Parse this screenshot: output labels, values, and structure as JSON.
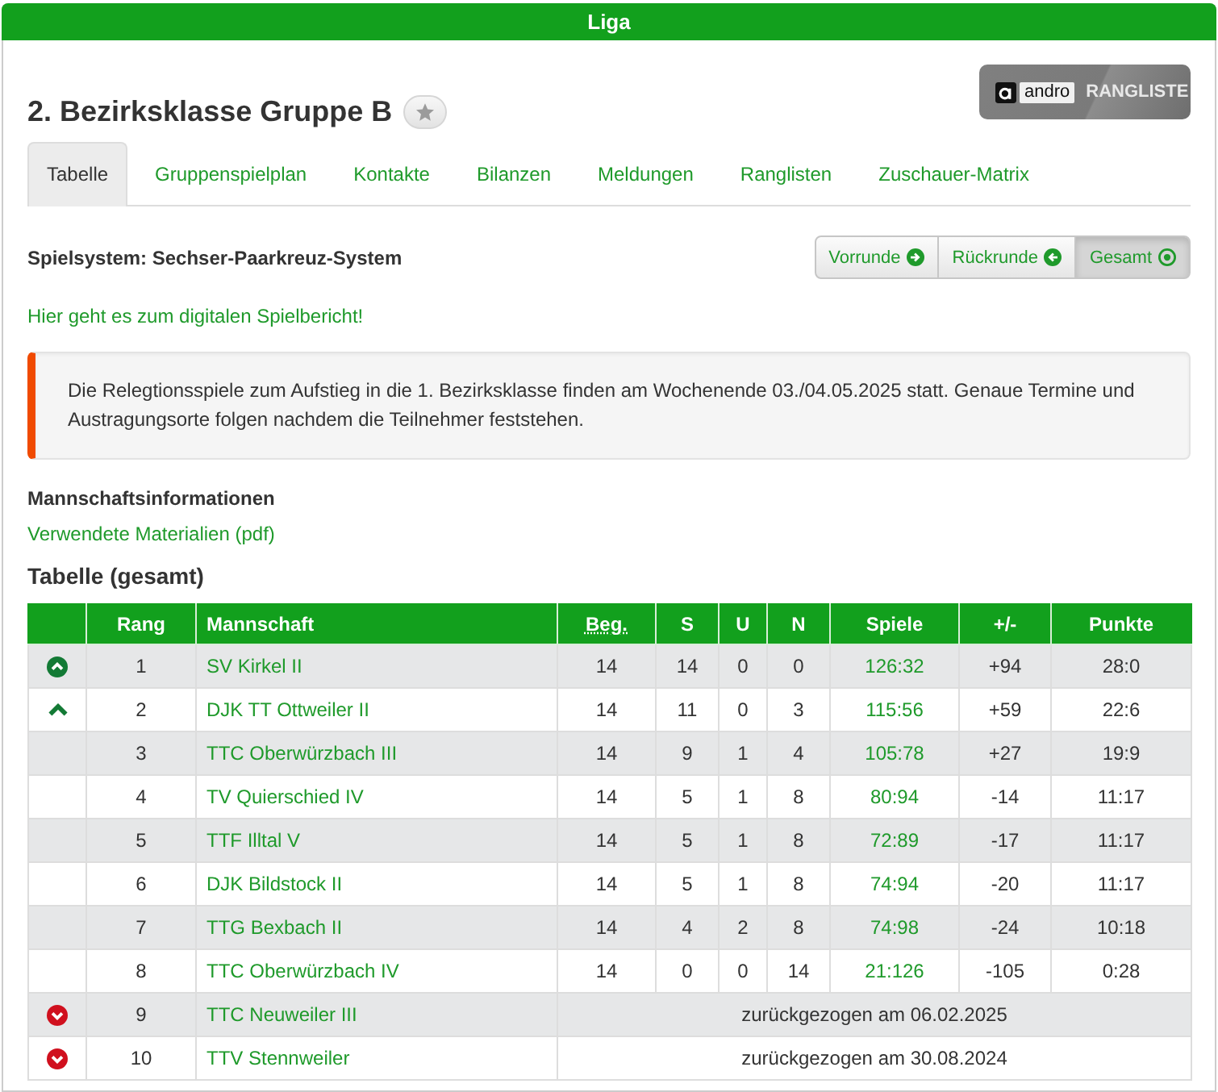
{
  "panel": {
    "title": "Liga"
  },
  "league": {
    "title": "2. Bezirksklasse Gruppe B"
  },
  "logo": {
    "brand": "andro",
    "label": "RANGLISTE"
  },
  "tabs": [
    {
      "label": "Tabelle",
      "selected": true
    },
    {
      "label": "Gruppenspielplan",
      "selected": false
    },
    {
      "label": "Kontakte",
      "selected": false
    },
    {
      "label": "Bilanzen",
      "selected": false
    },
    {
      "label": "Meldungen",
      "selected": false
    },
    {
      "label": "Ranglisten",
      "selected": false
    },
    {
      "label": "Zuschauer-Matrix",
      "selected": false
    }
  ],
  "system": {
    "label": "Spielsystem: Sechser-Paarkreuz-System"
  },
  "round_buttons": [
    {
      "label": "Vorrunde",
      "kind": "next",
      "selected": false
    },
    {
      "label": "Rückrunde",
      "kind": "previous",
      "selected": false
    },
    {
      "label": "Gesamt",
      "kind": "all",
      "selected": true
    }
  ],
  "report_link": "Hier geht es zum digitalen Spielbericht!",
  "notice": "Die Relegtionsspiele zum Aufstieg in die 1. Bezirksklasse finden am Wochenende 03./04.05.2025 statt. Genaue Termine und Austragungsorte folgen nachdem die Teilnehmer feststehen.",
  "team_info": {
    "heading": "Mannschaftsinformationen",
    "link": "Verwendete Materialien (pdf)"
  },
  "table": {
    "title": "Tabelle (gesamt)",
    "columns": [
      {
        "label": "Rang",
        "abbr": false
      },
      {
        "label": "Mannschaft",
        "abbr": false
      },
      {
        "label": "Beg.",
        "abbr": true
      },
      {
        "label": "S",
        "abbr": false
      },
      {
        "label": "U",
        "abbr": false
      },
      {
        "label": "N",
        "abbr": false
      },
      {
        "label": "Spiele",
        "abbr": false
      },
      {
        "label": "+/-",
        "abbr": false
      },
      {
        "label": "Punkte",
        "abbr": false
      }
    ],
    "rows": [
      {
        "kind": "promotion",
        "rank": "1",
        "team": "SV Kirkel II",
        "played": "14",
        "won": "14",
        "drawn": "0",
        "lost": "0",
        "games": "126:32",
        "diff": "+94",
        "points": "28:0"
      },
      {
        "kind": "playoff",
        "rank": "2",
        "team": "DJK TT Ottweiler II",
        "played": "14",
        "won": "11",
        "drawn": "0",
        "lost": "3",
        "games": "115:56",
        "diff": "+59",
        "points": "22:6"
      },
      {
        "kind": "regular",
        "rank": "3",
        "team": "TTC Oberwürzbach III",
        "played": "14",
        "won": "9",
        "drawn": "1",
        "lost": "4",
        "games": "105:78",
        "diff": "+27",
        "points": "19:9"
      },
      {
        "kind": "regular",
        "rank": "4",
        "team": "TV Quierschied IV",
        "played": "14",
        "won": "5",
        "drawn": "1",
        "lost": "8",
        "games": "80:94",
        "diff": "-14",
        "points": "11:17"
      },
      {
        "kind": "regular",
        "rank": "5",
        "team": "TTF Illtal V",
        "played": "14",
        "won": "5",
        "drawn": "1",
        "lost": "8",
        "games": "72:89",
        "diff": "-17",
        "points": "11:17"
      },
      {
        "kind": "regular",
        "rank": "6",
        "team": "DJK Bildstock II",
        "played": "14",
        "won": "5",
        "drawn": "1",
        "lost": "8",
        "games": "74:94",
        "diff": "-20",
        "points": "11:17"
      },
      {
        "kind": "regular",
        "rank": "7",
        "team": "TTG Bexbach II",
        "played": "14",
        "won": "4",
        "drawn": "2",
        "lost": "8",
        "games": "74:98",
        "diff": "-24",
        "points": "10:18"
      },
      {
        "kind": "regular",
        "rank": "8",
        "team": "TTC Oberwürzbach IV",
        "played": "14",
        "won": "0",
        "drawn": "0",
        "lost": "14",
        "games": "21:126",
        "diff": "-105",
        "points": "0:28"
      },
      {
        "kind": "withdrawn",
        "rank": "9",
        "team": "TTC Neuweiler III",
        "note": "zurückgezogen am 06.02.2025"
      },
      {
        "kind": "withdrawn",
        "rank": "10",
        "team": "TTV Stennweiler",
        "note": "zurückgezogen am 30.08.2024"
      }
    ]
  }
}
